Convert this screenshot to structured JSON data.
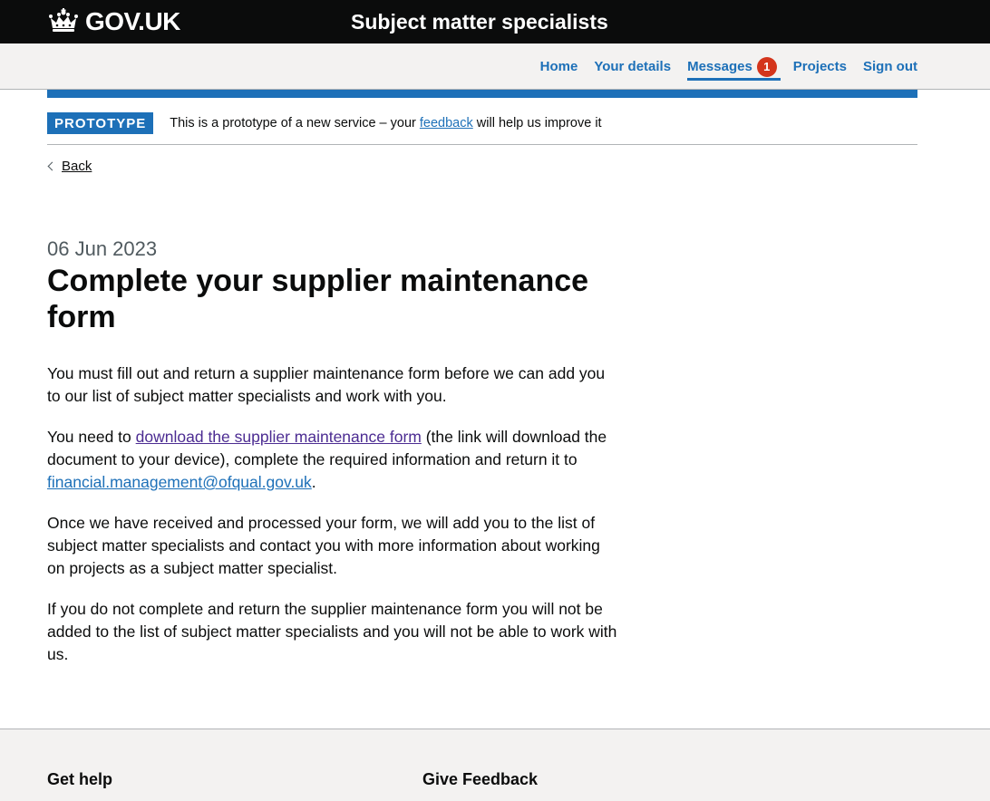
{
  "header": {
    "logo_text": "GOV.UK",
    "service_name": "Subject matter specialists"
  },
  "nav": {
    "items": [
      {
        "label": "Home"
      },
      {
        "label": "Your details"
      },
      {
        "label": "Messages",
        "badge": "1"
      },
      {
        "label": "Projects"
      },
      {
        "label": "Sign out"
      }
    ]
  },
  "phase_banner": {
    "tag": "PROTOTYPE",
    "text_before": "This is a prototype of a new service – your ",
    "link": "feedback",
    "text_after": " will help us improve it"
  },
  "back_link": "Back",
  "main": {
    "caption": "06 Jun 2023",
    "title": "Complete your supplier maintenance form",
    "p1": "You must fill out and return a supplier maintenance form before we can add you to our list of subject matter specialists and work with you.",
    "p2": {
      "text_before": "You need to ",
      "link": "download the supplier maintenance form",
      "text_middle": " (the link will download the document to your device), complete the required information and return it to ",
      "email": "financial.management@ofqual.gov.uk",
      "text_after": "."
    },
    "p3": "Once we have received and processed your form, we will add you to the list of subject matter specialists and contact you with more information about working on projects as a subject matter specialist.",
    "p4": "If you do not complete and return the supplier maintenance form you will not be added to the list of subject matter specialists and you will not be able to work with us."
  },
  "footer": {
    "heading_1": "Get help",
    "heading_2": "Give Feedback"
  },
  "colors": {
    "header_bg": "#0b0c0c",
    "link": "#1d70b8",
    "visited_link": "#4c2c92",
    "badge": "#d4351c",
    "footer_bg": "#f3f2f1"
  }
}
